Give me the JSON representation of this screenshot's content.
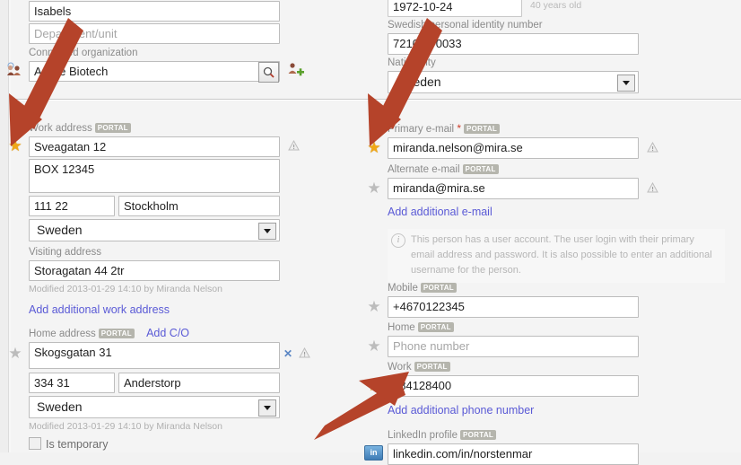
{
  "app": {
    "annotation_color": "#b5432a",
    "portal_badge": "PORTAL"
  },
  "left_column": {
    "name_field": {
      "value": "Isabels"
    },
    "department_field": {
      "placeholder": "Department/unit"
    },
    "connected_organization": {
      "label": "Connected organization",
      "value": "Active Biotech",
      "search_icon": "magnifier-icon",
      "add_icon": "add-organization-icon",
      "org_icon": "organization-icon"
    },
    "work_address": {
      "label": "Work address",
      "badge": "PORTAL",
      "street": "Sveagatan 12",
      "box": "BOX 12345",
      "zip": "111 22",
      "city": "Stockholm",
      "country": "Sweden",
      "visiting_label": "Visiting address",
      "visiting_value": "Storagatan 44 2tr",
      "modified": "Modified 2013-01-29 14:10 by Miranda Nelson",
      "add_link": "Add additional work address"
    },
    "home_address": {
      "label": "Home address",
      "badge": "PORTAL",
      "add_co_link": "Add C/O",
      "street": "Skogsgatan 31",
      "zip": "334 31",
      "city": "Anderstorp",
      "country": "Sweden",
      "modified": "Modified 2013-01-29 14:10 by Miranda Nelson",
      "is_temporary_label": "Is temporary"
    }
  },
  "right_column": {
    "birthdate": {
      "value": "1972-10-24",
      "age": "40 years old"
    },
    "personal_id": {
      "label": "Swedish personal identity number",
      "value": "721024-0033"
    },
    "nationality": {
      "label": "Nationality",
      "value": "Sweden"
    },
    "primary_email": {
      "label": "Primary e-mail",
      "required_marker": "*",
      "badge": "PORTAL",
      "value": "miranda.nelson@mira.se"
    },
    "alternate_email": {
      "label": "Alternate e-mail",
      "badge": "PORTAL",
      "value": "miranda@mira.se"
    },
    "add_email_link": "Add additional e-mail",
    "account_info": "This person has a user account. The user login with their primary email address and password. It is also possible to enter an additional username for the person.",
    "mobile": {
      "label": "Mobile",
      "badge": "PORTAL",
      "value": "+4670122345"
    },
    "home_phone": {
      "label": "Home",
      "badge": "PORTAL",
      "placeholder": "Phone number"
    },
    "work_phone": {
      "label": "Work",
      "badge": "PORTAL",
      "value": "084128400"
    },
    "add_phone_link": "Add additional phone number",
    "linkedin": {
      "label": "LinkedIn profile",
      "badge": "PORTAL",
      "value": "linkedin.com/in/norstenmar",
      "icon": "linkedin-icon"
    }
  }
}
